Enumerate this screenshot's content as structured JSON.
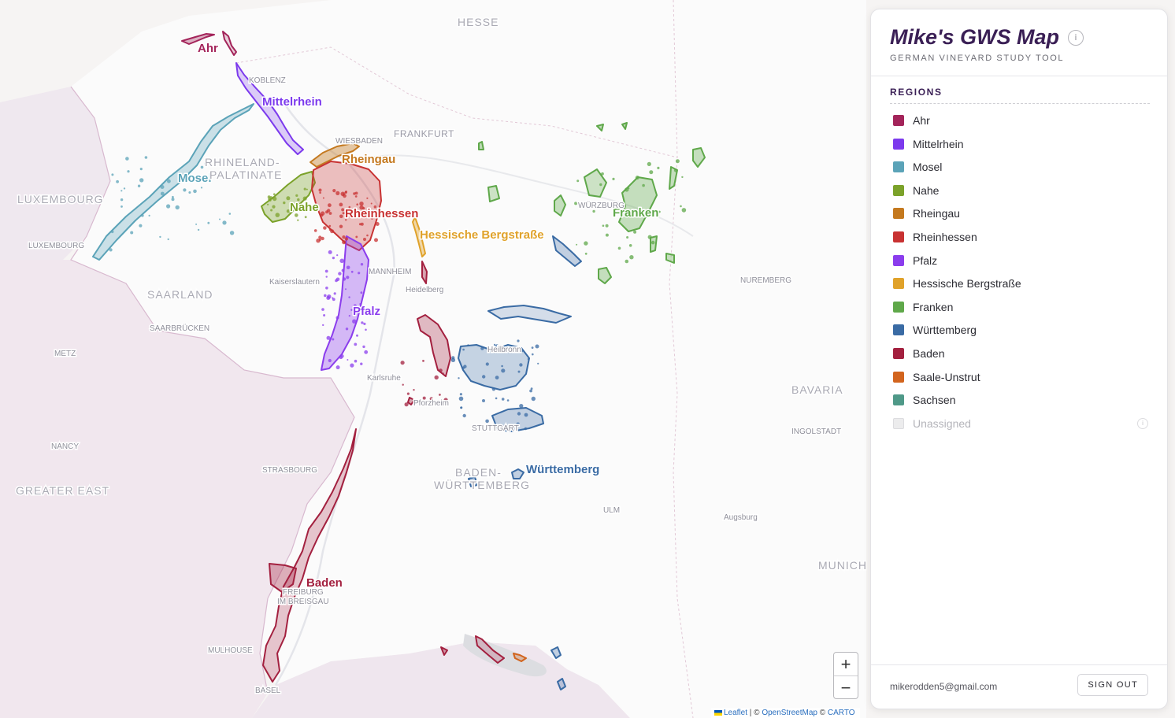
{
  "app": {
    "title": "Mike's GWS Map",
    "subtitle": "GERMAN VINEYARD STUDY TOOL",
    "info_icon": "info-icon",
    "info_glyph": "i"
  },
  "panel": {
    "regions_heading": "REGIONS",
    "regions": [
      {
        "name": "Ahr",
        "color": "#a3245a"
      },
      {
        "name": "Mittelrhein",
        "color": "#7c3aed"
      },
      {
        "name": "Mosel",
        "color": "#5ba3b8"
      },
      {
        "name": "Nahe",
        "color": "#7ba22a"
      },
      {
        "name": "Rheingau",
        "color": "#c4791f"
      },
      {
        "name": "Rheinhessen",
        "color": "#c83232"
      },
      {
        "name": "Pfalz",
        "color": "#8b3ded"
      },
      {
        "name": "Hessische Bergstraße",
        "color": "#e0a22a"
      },
      {
        "name": "Franken",
        "color": "#5fa84a"
      },
      {
        "name": "Württemberg",
        "color": "#3a6ba4"
      },
      {
        "name": "Baden",
        "color": "#a3203f"
      },
      {
        "name": "Saale-Unstrut",
        "color": "#d2641e"
      },
      {
        "name": "Sachsen",
        "color": "#4f9988"
      },
      {
        "name": "Unassigned",
        "color": "#ececed",
        "muted": true
      }
    ],
    "user_email": "mikerodden5@gmail.com",
    "sign_out_label": "SIGN OUT"
  },
  "map": {
    "zoom_in_label": "+",
    "zoom_out_label": "−",
    "attribution": {
      "leaflet": "Leaflet",
      "sep1": " | © ",
      "osm": "OpenStreetMap",
      "sep2": " © ",
      "carto": "CARTO"
    },
    "region_labels": {
      "ahr": "Ahr",
      "mittelrhein": "Mittelrhein",
      "mosel": "Mosel",
      "nahe": "Nahe",
      "rheingau": "Rheingau",
      "rheinhessen": "Rheinhessen",
      "bergstrasse": "Hessische Bergstraße",
      "franken": "Franken",
      "pfalz": "Pfalz",
      "wuerttemberg": "Württemberg",
      "baden": "Baden"
    },
    "place_labels": {
      "hesse": "HESSE",
      "koblenz": "KOBLENZ",
      "wiesbaden": "WIESBADEN",
      "frankfurt": "FRANKFURT",
      "rheinland_1": "RHINELAND-",
      "rheinland_2": "PALATINATE",
      "luxembourg_country": "LUXEMBOURG",
      "luxembourg_city": "LUXEMBOURG",
      "wuerzburg": "WÜRZBURG",
      "mannheim": "MANNHEIM",
      "heidelberg": "Heidelberg",
      "kaiserslautern": "Kaiserslautern",
      "saarland": "SAARLAND",
      "saarbruecken": "SAARBRÜCKEN",
      "nuremberg": "NUREMBERG",
      "heilbronn": "Heilbronn",
      "metz": "METZ",
      "karlsruhe": "Karlsruhe",
      "pforzheim": "Pforzheim",
      "bavaria": "BAVARIA",
      "stuttgart": "STUTTGART",
      "ingolstadt": "INGOLSTADT",
      "nancy": "NANCY",
      "strasbourg": "STRASBOURG",
      "bw_1": "BADEN-",
      "bw_2": "WÜRTTEMBERG",
      "greater_east": "GREATER EAST",
      "ulm": "ULM",
      "augsburg": "Augsburg",
      "munich": "MUNICH",
      "freiburg_1": "FREIBURG",
      "freiburg_2": "IM BREISGAU",
      "mulhouse": "MULHOUSE",
      "basel": "BASEL"
    }
  }
}
